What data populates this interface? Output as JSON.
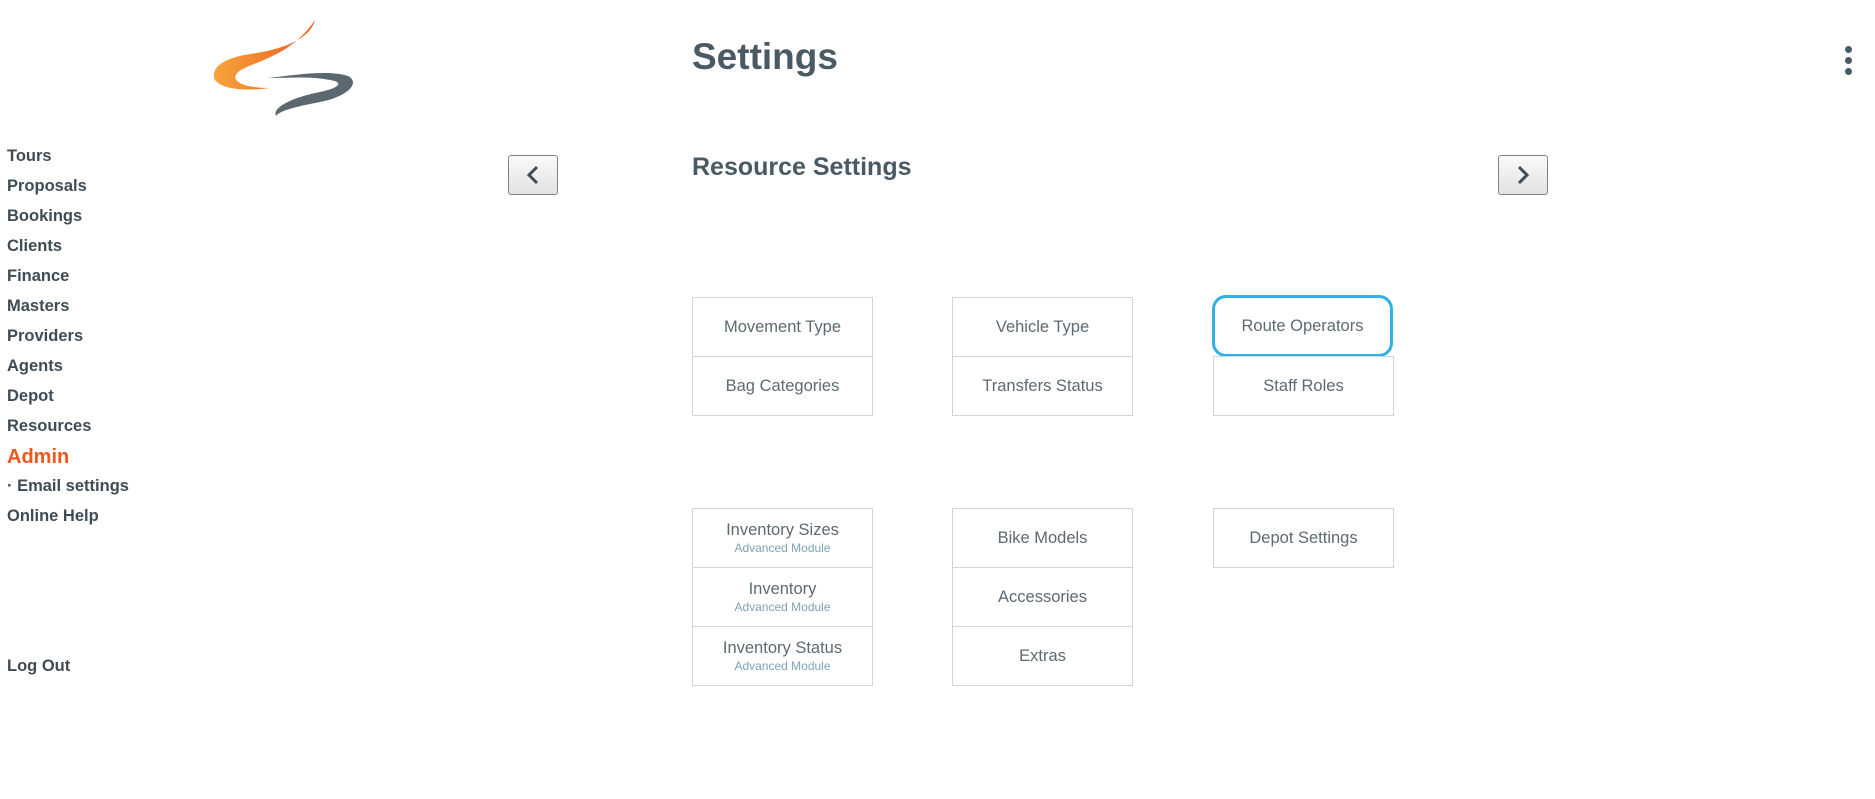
{
  "header": {
    "title": "Settings"
  },
  "sidebar": {
    "items": [
      {
        "label": "Tours"
      },
      {
        "label": "Proposals"
      },
      {
        "label": "Bookings"
      },
      {
        "label": "Clients"
      },
      {
        "label": "Finance"
      },
      {
        "label": "Masters"
      },
      {
        "label": "Providers"
      },
      {
        "label": "Agents"
      },
      {
        "label": "Depot"
      },
      {
        "label": "Resources"
      },
      {
        "label": "Admin",
        "active": true
      },
      {
        "label": "· Email settings"
      },
      {
        "label": "Online Help"
      }
    ],
    "logout": "Log Out"
  },
  "main": {
    "section_title": "Resource Settings",
    "group1": [
      {
        "label": "Movement Type"
      },
      {
        "label": "Vehicle Type"
      },
      {
        "label": "Route Operators",
        "focused": true
      },
      {
        "label": "Bag Categories"
      },
      {
        "label": "Transfers Status"
      },
      {
        "label": "Staff Roles"
      }
    ],
    "group2": [
      {
        "label": "Inventory Sizes",
        "sub": "Advanced Module"
      },
      {
        "label": "Bike Models"
      },
      {
        "label": "Depot Settings"
      },
      {
        "label": "Inventory",
        "sub": "Advanced Module"
      },
      {
        "label": "Accessories"
      },
      {
        "label": "Inventory Status",
        "sub": "Advanced Module"
      },
      {
        "label": "Extras"
      }
    ]
  },
  "icons": {
    "logo": "brand-swoosh-logo",
    "menu": "more-vertical-icon",
    "prev": "chevron-left-icon",
    "next": "chevron-right-icon"
  },
  "colors": {
    "accent": "#f0561e",
    "focus": "#2fb0e6",
    "text": "#4a5a64",
    "sub_text": "#7ea3b4"
  }
}
